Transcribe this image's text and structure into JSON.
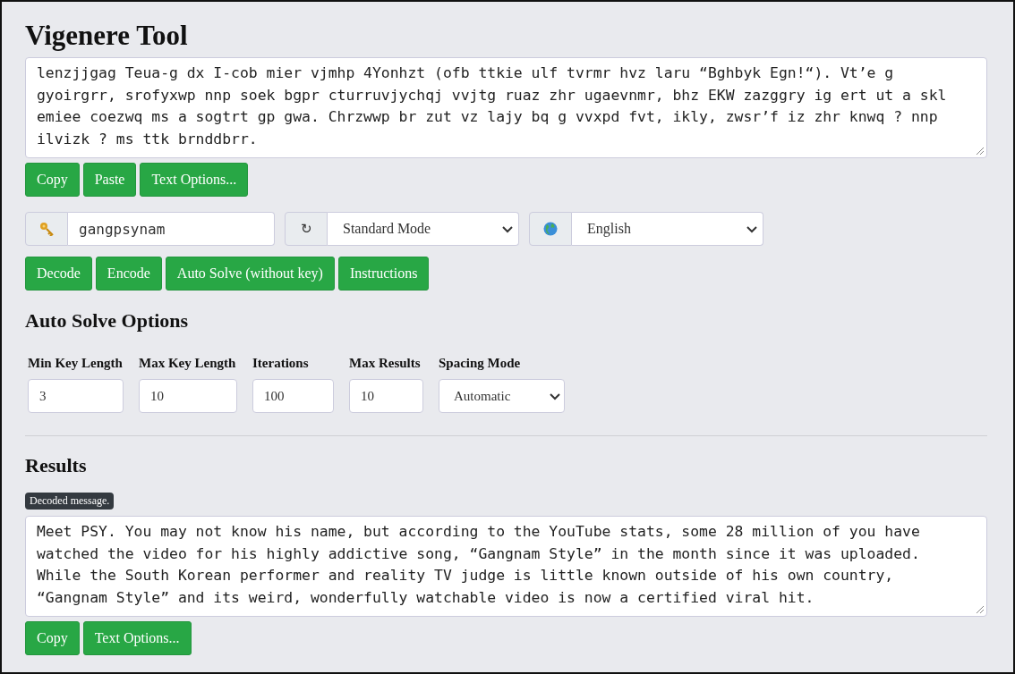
{
  "title": "Vigenere Tool",
  "input_text": {
    "value": "lenzjjgag Teua-g dx I-cob mier vjmhp 4Yonhzt (ofb ttkie ulf tvrmr hvz laru “Bghbyk Egn!“). Vt’e g\ngyoirgrr, srofyxwp nnp soek bgpr cturruvjychqj vvjtg ruaz zhr ugaevnmr, bhz EKW zazggry ig ert ut a skl\nemiee coezwq ms a sogtrt gp gwa. Chrzwwp br zut vz lajy bq g vvxpd fvt, ikly, zwsr’f iz zhr knwq ? nnp\nilvizk ? ms ttk brnddbrr."
  },
  "text_buttons": [
    "Copy",
    "Paste",
    "Text Options..."
  ],
  "controls": [
    {
      "kind": "input",
      "value": "gangpsynam"
    },
    {
      "kind": "select",
      "addon_text": "↻",
      "value": "Standard Mode"
    },
    {
      "kind": "select",
      "value": "English"
    }
  ],
  "action_buttons": [
    "Decode",
    "Encode",
    "Auto Solve (without key)",
    "Instructions"
  ],
  "options_heading": "Auto Solve Options",
  "options": [
    {
      "label": "Min Key Length",
      "kind": "input",
      "value": "3"
    },
    {
      "label": "Max Key Length",
      "kind": "input",
      "value": "10"
    },
    {
      "label": "Iterations",
      "kind": "input",
      "value": "100"
    },
    {
      "label": "Max Results",
      "kind": "input",
      "value": "10"
    },
    {
      "label": "Spacing Mode",
      "kind": "select",
      "value": "Automatic"
    }
  ],
  "results_heading": "Results",
  "results_badge": "Decoded message.",
  "output_text": {
    "value": "Meet PSY. You may not know his name, but according to the YouTube stats, some 28 million of you have\nwatched the video for his highly addictive song, “Gangnam Style” in the month since it was uploaded.\nWhile the South Korean performer and reality TV judge is little known outside of his own country,\n“Gangnam Style” and its weird, wonderfully watchable video is now a certified viral hit."
  },
  "result_buttons": [
    "Copy",
    "Text Options..."
  ]
}
